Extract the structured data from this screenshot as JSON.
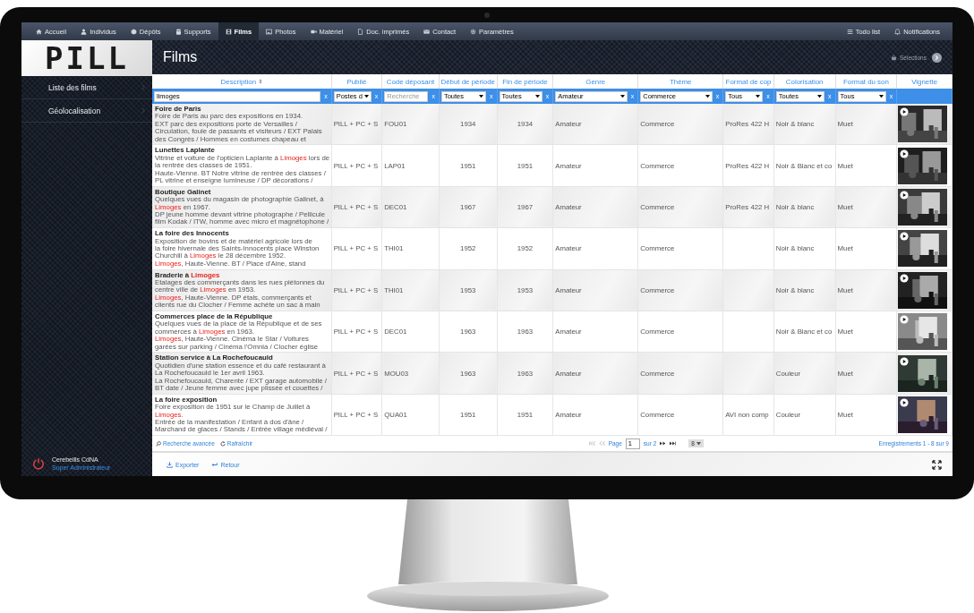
{
  "nav": {
    "items": [
      {
        "label": "Accueil",
        "selected": false
      },
      {
        "label": "Individus",
        "selected": false
      },
      {
        "label": "Dépôts",
        "selected": false
      },
      {
        "label": "Supports",
        "selected": false
      },
      {
        "label": "Films",
        "selected": true
      },
      {
        "label": "Photos",
        "selected": false
      },
      {
        "label": "Matériel",
        "selected": false
      },
      {
        "label": "Doc. imprimés",
        "selected": false
      },
      {
        "label": "Contact",
        "selected": false
      },
      {
        "label": "Paramètres",
        "selected": false
      }
    ],
    "right": [
      "Todo list",
      "Notifications"
    ]
  },
  "sidebar": {
    "logo": "PILL",
    "items": [
      "Liste des films",
      "Géolocalisation"
    ],
    "user": {
      "name": "Cerebellis CdNA",
      "role": "Super Administrateur"
    }
  },
  "header": {
    "title": "Films",
    "selections": "Sélections"
  },
  "table": {
    "columns": [
      "Description",
      "Publié",
      "Code déposant",
      "Début de période",
      "Fin de période",
      "Genre",
      "Thème",
      "Format de cop",
      "Colorisation",
      "Format du son",
      "Vignette"
    ],
    "filters": [
      {
        "kind": "input",
        "value": "limoges",
        "clear": "x"
      },
      {
        "kind": "select",
        "value": "Postes d",
        "clear": "x"
      },
      {
        "kind": "input",
        "placeholder": "Recherche",
        "clear": "x"
      },
      {
        "kind": "select",
        "value": "Toutes",
        "clear": "x"
      },
      {
        "kind": "select",
        "value": "Toutes",
        "clear": "x"
      },
      {
        "kind": "select",
        "value": "Amateur",
        "clear": "x"
      },
      {
        "kind": "select",
        "value": "Commerce",
        "clear": "x"
      },
      {
        "kind": "select",
        "value": "Tous",
        "clear": "x"
      },
      {
        "kind": "select",
        "value": "Toutes",
        "clear": "x"
      },
      {
        "kind": "select",
        "value": "Tous",
        "clear": "x"
      }
    ],
    "rows": [
      {
        "title": [
          {
            "text": "Foire de Paris",
            "highlight": false
          }
        ],
        "description": [
          {
            "text": "Foire de Paris au parc des expositions en 1934.\nEXT parc des expositions porte de Versailles /\nCirculation, foule de passants et visiteurs / EXT Palais\ndes Congrès / Hommes en costumes chapeau et",
            "highlight": false
          }
        ],
        "published": "PILL + PC + S",
        "code": "FOU01",
        "start": "1934",
        "end": "1934",
        "genre": "Amateur",
        "theme": "Commerce",
        "format": "ProRes 422 H",
        "colorisation": "Noir & blanc",
        "sound": "Muet",
        "thumbnail": {
          "kind": "picture"
        }
      },
      {
        "title": [
          {
            "text": "Lunettes Laplante",
            "highlight": false
          }
        ],
        "description": [
          {
            "text": "Vitrine et voiture de l'opticien Laplante à ",
            "highlight": false
          },
          {
            "text": "Limoges",
            "highlight": true
          },
          {
            "text": " lors de\nla rentrée des classes de 1951.\nHaute-Vienne. BT Notre vitrine de rentrée des classes /\nPL vitrine et enseigne lumineuse / DP décorations /",
            "highlight": false
          }
        ],
        "published": "PILL + PC + S",
        "code": "LAP01",
        "start": "1951",
        "end": "1951",
        "genre": "Amateur",
        "theme": "Commerce",
        "format": "ProRes 422 H",
        "colorisation": "Noir & Blanc et co",
        "sound": "Muet",
        "thumbnail": {
          "kind": "picture"
        }
      },
      {
        "title": [
          {
            "text": "Boutique Galinet",
            "highlight": false
          }
        ],
        "description": [
          {
            "text": "Quelques vues du magasin de photographie Galinet, à\n",
            "highlight": false
          },
          {
            "text": "Limoges",
            "highlight": true
          },
          {
            "text": " en 1967.\nDP jeune homme devant vitrine photographe / Pellicule\nfilm Kodak / ITW, homme avec micro et magnétophone /",
            "highlight": false
          }
        ],
        "published": "PILL + PC + S",
        "code": "DEC01",
        "start": "1967",
        "end": "1967",
        "genre": "Amateur",
        "theme": "Commerce",
        "format": "ProRes 422 H",
        "colorisation": "Noir & blanc",
        "sound": "Muet",
        "thumbnail": {
          "kind": "picture"
        }
      },
      {
        "title": [
          {
            "text": "La foire des Innocents",
            "highlight": false
          }
        ],
        "description": [
          {
            "text": "Exposition de bovins et de matériel agricole lors de\nla foire hivernale des Saints-Innocents place Winston\nChurchill à ",
            "highlight": false
          },
          {
            "text": "Limoges",
            "highlight": true
          },
          {
            "text": " le 28 décembre 1952.\n",
            "highlight": false
          },
          {
            "text": "Limoges",
            "highlight": true
          },
          {
            "text": ", Haute-Vienne. BT / Place d'Aine, stand",
            "highlight": false
          }
        ],
        "published": "PILL + PC + S",
        "code": "THI01",
        "start": "1952",
        "end": "1952",
        "genre": "Amateur",
        "theme": "Commerce",
        "colorisation": "Noir & blanc",
        "sound": "Muet",
        "thumbnail": {
          "kind": "picture"
        }
      },
      {
        "title": [
          {
            "text": "Braderie à ",
            "highlight": false
          },
          {
            "text": "Limoges",
            "highlight": true
          }
        ],
        "description": [
          {
            "text": "Etalages des commerçants dans les rues piétonnes du\ncentre ville de ",
            "highlight": false
          },
          {
            "text": "Limoges",
            "highlight": true
          },
          {
            "text": " en 1953.\n",
            "highlight": false
          },
          {
            "text": "Limoges",
            "highlight": true
          },
          {
            "text": ", Haute-Vienne. DP étals, commerçants et\nclients rue du Clocher / Femme achète un sac à main",
            "highlight": false
          }
        ],
        "published": "PILL + PC + S",
        "code": "THI01",
        "start": "1953",
        "end": "1953",
        "genre": "Amateur",
        "theme": "Commerce",
        "colorisation": "Noir & blanc",
        "sound": "Muet",
        "thumbnail": {
          "kind": "picture"
        }
      },
      {
        "title": [
          {
            "text": "Commerces place de la République",
            "highlight": false
          }
        ],
        "description": [
          {
            "text": "Quelques vues de la place de la République et de ses\ncommerces à ",
            "highlight": false
          },
          {
            "text": "Limoges",
            "highlight": true
          },
          {
            "text": " en 1963.\n",
            "highlight": false
          },
          {
            "text": "Limoges",
            "highlight": true
          },
          {
            "text": ", Haute-Vienne. Cinéma le Star / Voitures\ngarées sur parking / Cinéma l'Omnia / Clocher église",
            "highlight": false
          }
        ],
        "published": "PILL + PC + S",
        "code": "DEC01",
        "start": "1963",
        "end": "1963",
        "genre": "Amateur",
        "theme": "Commerce",
        "colorisation": "Noir & Blanc et co",
        "sound": "Muet",
        "thumbnail": {
          "kind": "picture"
        }
      },
      {
        "title": [
          {
            "text": "Station service à La Rochefoucauld",
            "highlight": false
          }
        ],
        "description": [
          {
            "text": "Quotidien d'une station essence et du café restaurant à\nLa Rochefoucauld le 1er avril 1963.\nLa Rochefoucauld, Charente / EXT garage automobile /\nBT date / Jeune femme avec jupe plissée et couettes /",
            "highlight": false
          }
        ],
        "published": "PILL + PC + S",
        "code": "MOU03",
        "start": "1963",
        "end": "1963",
        "genre": "Amateur",
        "theme": "Commerce",
        "colorisation": "Couleur",
        "sound": "Muet",
        "thumbnail": {
          "kind": "picture"
        }
      },
      {
        "title": [
          {
            "text": "La foire exposition",
            "highlight": false
          }
        ],
        "description": [
          {
            "text": "Foire exposition de 1951 sur le Champ de Juillet à\n",
            "highlight": false
          },
          {
            "text": "Limoges",
            "highlight": true
          },
          {
            "text": ".\nEntrée de la manifestation / Enfant à dos d'âne /\nMarchand de glaces / Stands / Entrée village médiéval /",
            "highlight": false
          }
        ],
        "published": "PILL + PC + S",
        "code": "QUA01",
        "start": "1951",
        "end": "1951",
        "genre": "Amateur",
        "theme": "Commerce",
        "format": "AVI  non comp",
        "colorisation": "Couleur",
        "sound": "Muet",
        "thumbnail": {
          "kind": "picture"
        }
      }
    ]
  },
  "pager": {
    "links": [
      "Recherche avancée",
      "Rafraîchir"
    ],
    "page_label": "Page",
    "page": "1",
    "of": "sur 2",
    "page_size": "8",
    "records": "Enregistrements 1 - 8 sur 9"
  },
  "actions": [
    "Exporter",
    "Retour"
  ]
}
